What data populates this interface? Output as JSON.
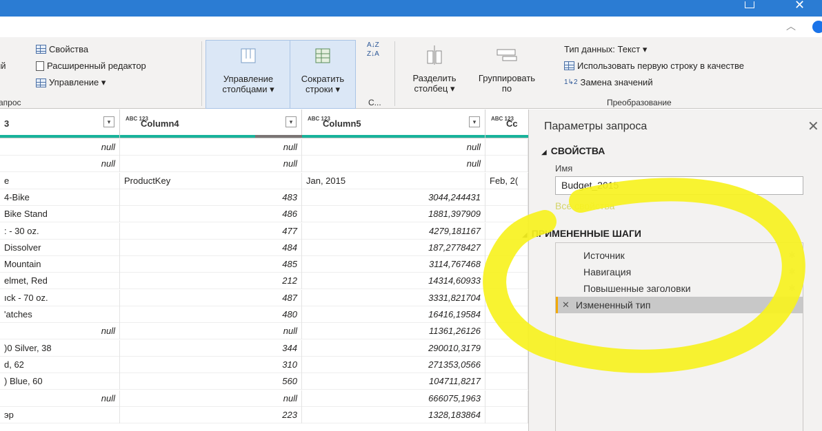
{
  "ribbon": {
    "properties": "Свойства",
    "advanced_editor": "Расширенный редактор",
    "manage": "Управление ▾",
    "left_fragment": "ий",
    "group_query": "апрос",
    "manage_columns": [
      "Управление",
      "столбцами ▾"
    ],
    "reduce_rows": [
      "Сократить",
      "строки ▾"
    ],
    "sort_group": "С...",
    "split_column": [
      "Разделить",
      "столбец ▾"
    ],
    "group_by": [
      "Группировать",
      "по"
    ],
    "data_type": "Тип данных: Текст ▾",
    "use_first_row": "Использовать первую строку в качестве",
    "replace_values": "Замена значений",
    "group_transform": "Преобразование"
  },
  "headers": [
    {
      "type": "",
      "name": "3"
    },
    {
      "type": "ABC 123",
      "name": "Column4"
    },
    {
      "type": "ABC 123",
      "name": "Column5"
    },
    {
      "type": "ABC 123",
      "name": "Cc"
    }
  ],
  "rows": [
    {
      "c3": "null",
      "c4": "null",
      "c5": "null",
      "c6": ""
    },
    {
      "c3": "null",
      "c4": "null",
      "c5": "null",
      "c6": ""
    },
    {
      "c3": "e",
      "c4": "ProductKey",
      "c5": "Jan, 2015",
      "c6": "Feb, 2("
    },
    {
      "c3": "4-Bike",
      "c4": "483",
      "c5": "3044,244431",
      "c6": ""
    },
    {
      "c3": "Bike Stand",
      "c4": "486",
      "c5": "1881,397909",
      "c6": ""
    },
    {
      "c3": ": - 30 oz.",
      "c4": "477",
      "c5": "4279,181167",
      "c6": ""
    },
    {
      "c3": "Dissolver",
      "c4": "484",
      "c5": "187,2778427",
      "c6": ""
    },
    {
      "c3": "Mountain",
      "c4": "485",
      "c5": "3114,767468",
      "c6": ""
    },
    {
      "c3": "elmet, Red",
      "c4": "212",
      "c5": "14314,60933",
      "c6": ""
    },
    {
      "c3": "ıck - 70 oz.",
      "c4": "487",
      "c5": "3331,821704",
      "c6": ""
    },
    {
      "c3": "'atches",
      "c4": "480",
      "c5": "16416,19584",
      "c6": ""
    },
    {
      "c3": "null",
      "c4": "null",
      "c5": "11361,26126",
      "c6": ""
    },
    {
      "c3": ")0 Silver, 38",
      "c4": "344",
      "c5": "290010,3179",
      "c6": ""
    },
    {
      "c3": "d, 62",
      "c4": "310",
      "c5": "271353,0566",
      "c6": ""
    },
    {
      "c3": ") Blue, 60",
      "c4": "560",
      "c5": "104711,8217",
      "c6": ""
    },
    {
      "c3": "null",
      "c4": "null",
      "c5": "666075,1963",
      "c6": ""
    },
    {
      "c3": "эр",
      "c4": "223",
      "c5": "1328,183864",
      "c6": ""
    }
  ],
  "panel": {
    "title": "Параметры запроса",
    "properties_section": "СВОЙСТВА",
    "name_label": "Имя",
    "name_value": "Budget_2015",
    "all_properties": "Все свойства",
    "steps_section": "ПРИМЕНЕННЫЕ ШАГИ",
    "steps": [
      "Источник",
      "Навигация",
      "Повышенные заголовки",
      "Измененный тип"
    ]
  },
  "colors": {
    "title_bar": "#2b7cd3",
    "header_bar_green": "#19b39b",
    "header_bar_gray": "#7a7574",
    "highlight_yellow": "#f7f21f",
    "selected_step_accent": "#f2a900"
  }
}
